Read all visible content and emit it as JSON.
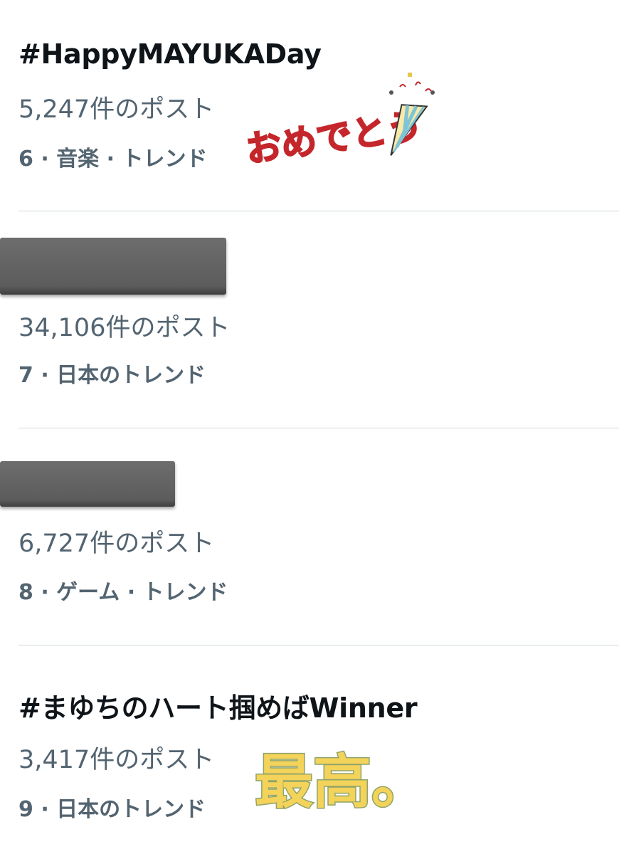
{
  "trends": [
    {
      "title": "#HappyMAYUKADay",
      "count": "5,247件のポスト",
      "meta": "6 · 音楽 · トレンド"
    },
    {
      "title": "",
      "count": "34,106件のポスト",
      "meta": "7 · 日本のトレンド",
      "redacted": true
    },
    {
      "title": "",
      "count": "6,727件のポスト",
      "meta": "8 · ゲーム · トレンド",
      "redacted": true
    },
    {
      "title": "#まゆちのハート掴めばWinner",
      "count": "3,417件のポスト",
      "meta": "9 · 日本のトレンド"
    }
  ],
  "stickers": {
    "omedetou": "おめでとう",
    "saikou": "最高。"
  },
  "colors": {
    "title": "#0f1419",
    "secondary": "#536471",
    "divider": "#cfd9de",
    "sticker_red": "#c4262b",
    "sticker_yellow": "#f3d35a"
  }
}
